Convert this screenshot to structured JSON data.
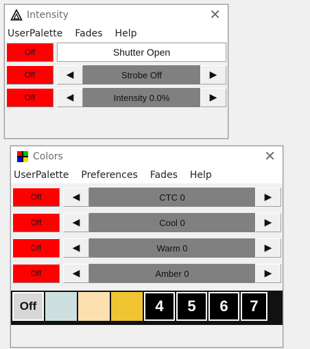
{
  "intensity_window": {
    "title": "Intensity",
    "menu": [
      "UserPalette",
      "Fades",
      "Help"
    ],
    "rows": [
      {
        "off_label": "Off",
        "label": "Shutter Open"
      },
      {
        "off_label": "Off",
        "label": "Strobe Off"
      },
      {
        "off_label": "Off",
        "label": "Intensity 0.0%"
      }
    ]
  },
  "colors_window": {
    "title": "Colors",
    "menu": [
      "UserPalette",
      "Preferences",
      "Fades",
      "Help"
    ],
    "rows": [
      {
        "off_label": "Off",
        "label": "CTC 0"
      },
      {
        "off_label": "Off",
        "label": "Cool 0"
      },
      {
        "off_label": "Off",
        "label": "Warm 0"
      },
      {
        "off_label": "Off",
        "label": "Amber 0"
      }
    ],
    "palette": {
      "off_label": "Off",
      "colors": [
        "#cde0df",
        "#fde0b0",
        "#f0c531"
      ],
      "numbers": [
        "4",
        "5",
        "6",
        "7"
      ]
    }
  },
  "glyphs": {
    "close": "✕",
    "left": "◀",
    "right": "▶"
  },
  "icons": {
    "intensity": "triangle-icon",
    "colors": "color-grid-icon"
  },
  "colors": {
    "off_red": "#ff0000",
    "label_grey": "#808080"
  }
}
